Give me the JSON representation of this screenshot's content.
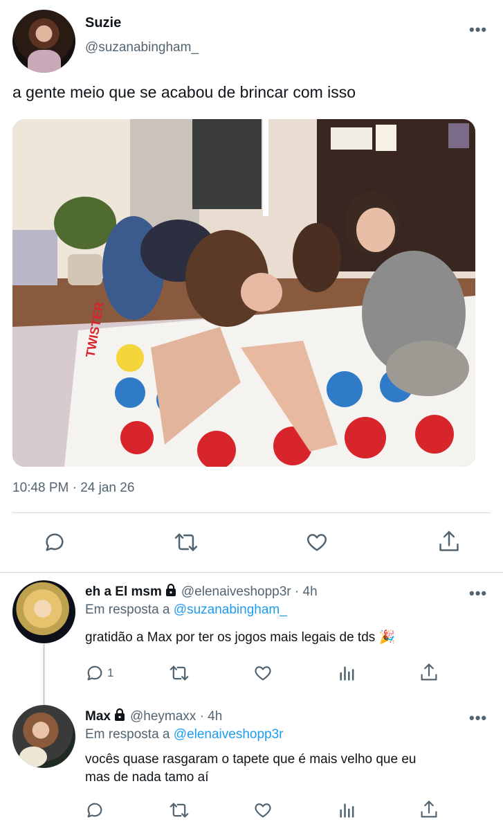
{
  "tweet": {
    "author_name": "Suzie",
    "author_handle": "@suzanabingham_",
    "text": "a gente meio que se acabou de brincar com isso",
    "timestamp": "10:48 PM · 24 jan 26",
    "more_icon": "more-horizontal-icon"
  },
  "replies": [
    {
      "name": "eh a El msm",
      "handle": "@elenaiveshopp3r",
      "time": "· 4h",
      "reply_prefix": "Em resposta a",
      "reply_to": "@suzanabingham_",
      "text": "gratidão a Max por ter os jogos mais legais de tds 🎉",
      "reply_count": "1"
    },
    {
      "name": "Max",
      "handle": "@heymaxx",
      "time": "· 4h",
      "reply_prefix": "Em resposta a",
      "reply_to": "@elenaiveshopp3r",
      "text_line1": "vocês quase rasgaram o tapete que é mais velho que eu",
      "text_line2": "mas de nada tamo aí",
      "reply_count": ""
    }
  ],
  "colors": {
    "text": "#0f1419",
    "secondary": "#536471",
    "link": "#1d9bf0",
    "divider": "#cfd9de"
  }
}
